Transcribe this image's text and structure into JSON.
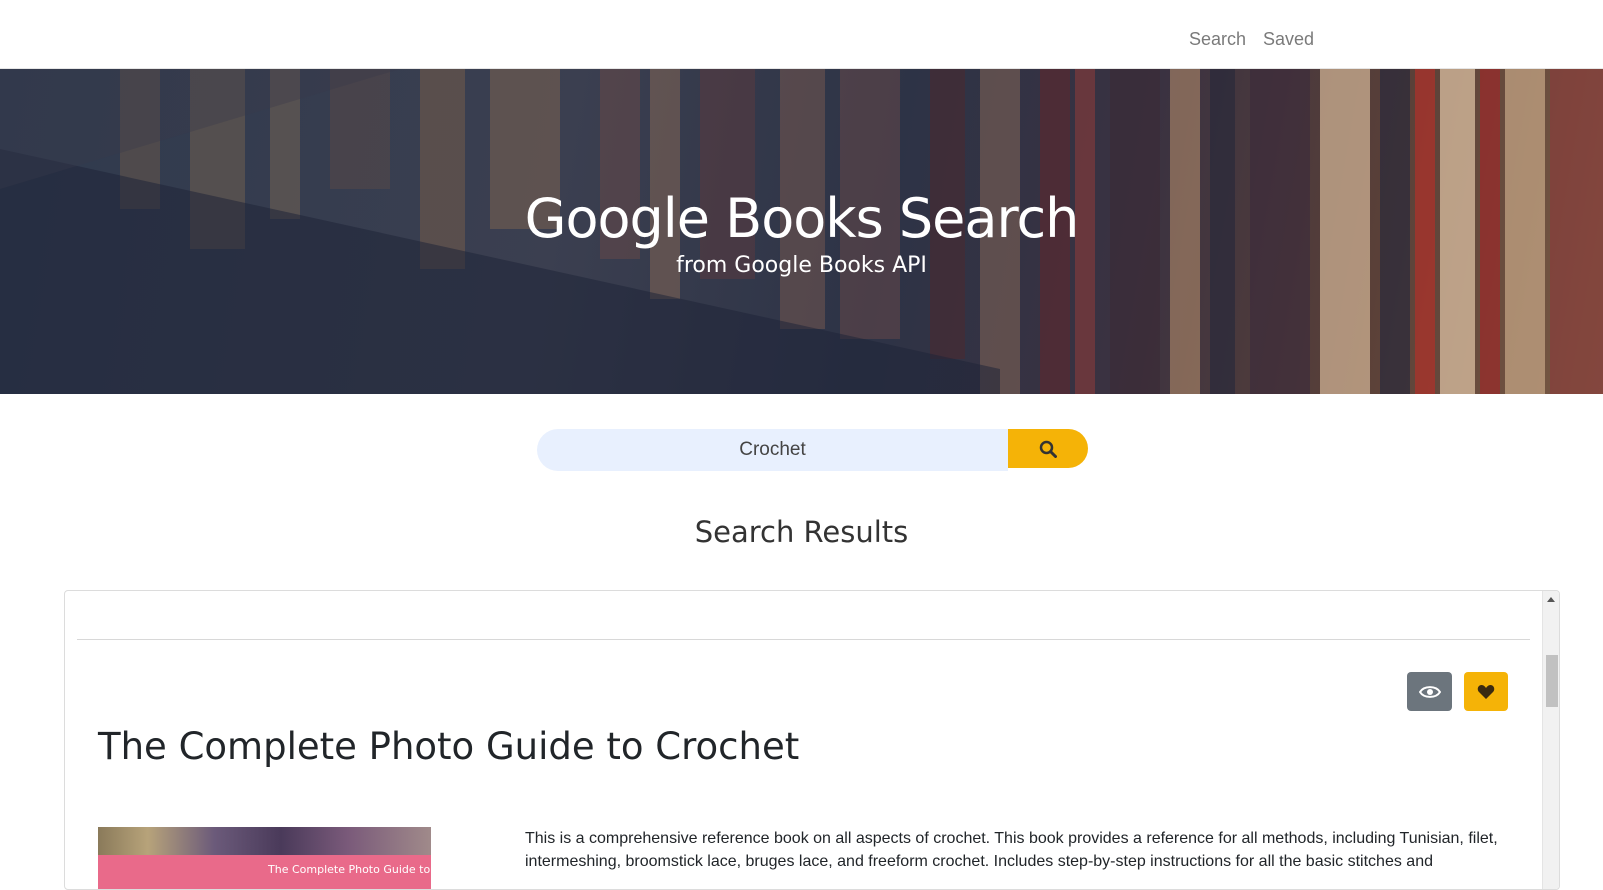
{
  "nav": {
    "search_label": "Search",
    "saved_label": "Saved"
  },
  "hero": {
    "title": "Google Books Search",
    "subtitle": "from Google Books API"
  },
  "search": {
    "value": "Crochet"
  },
  "results": {
    "heading": "Search Results",
    "items": [
      {
        "title": "The Complete Photo Guide to Crochet",
        "cover_text": "The Complete Photo Guide to",
        "description": "This is a comprehensive reference book on all aspects of crochet. This book provides a reference for all methods, including Tunisian, filet, intermeshing, broomstick lace, bruges lace, and freeform crochet. Includes step-by-step instructions for all the basic stitches and"
      }
    ]
  },
  "colors": {
    "accent": "#f5b307",
    "secondary": "#6c757d",
    "input_bg": "#e8f0fe"
  },
  "icons": {
    "search_button": "search-icon",
    "view_button": "eye-icon",
    "save_button": "heart-icon"
  }
}
